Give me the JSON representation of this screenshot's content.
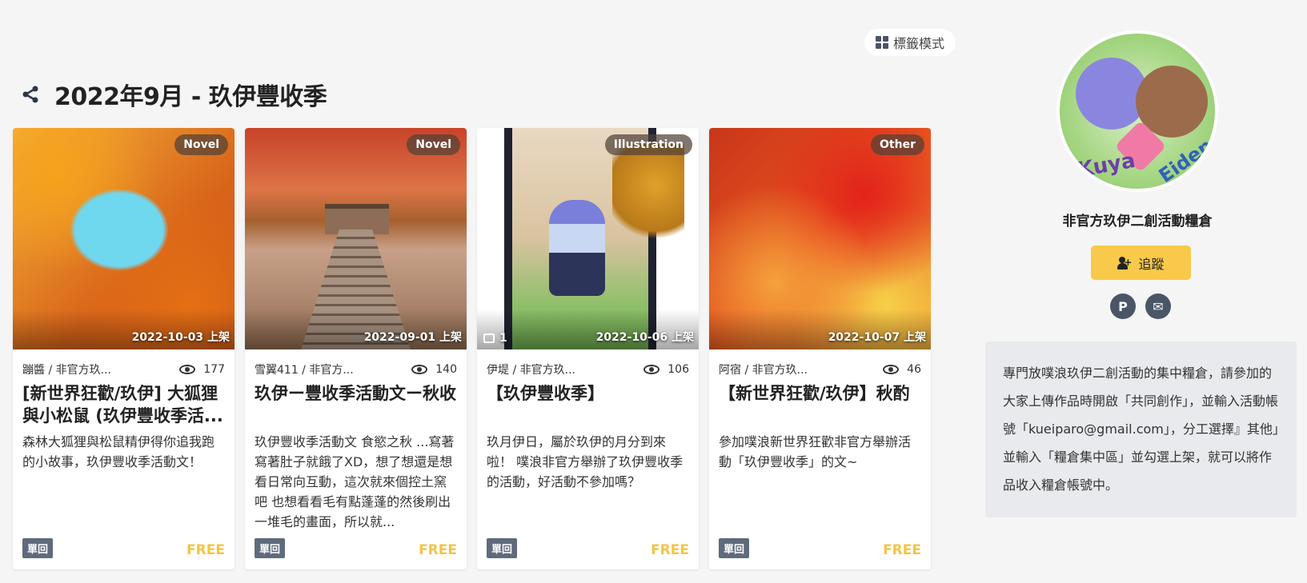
{
  "header": {
    "tag_mode_label": "標籤模式",
    "title": "2022年9月 - 玖伊豐收季"
  },
  "cards": [
    {
      "type": "Novel",
      "date": "2022-10-03 上架",
      "author": "蹦醬 / 非官方玖...",
      "views": "177",
      "title": "[新世界狂歡/玖伊] 大狐狸與小松鼠 (玖伊豐收季活...",
      "desc": "森林大狐狸與松鼠精伊得你追我跑的小故事，玖伊豐收季活動文！",
      "tag": "單回",
      "price": "FREE"
    },
    {
      "type": "Novel",
      "date": "2022-09-01 上架",
      "author": "雪翼411 / 非官方...",
      "views": "140",
      "title": "玖伊ー豐收季活動文ー秋收",
      "desc": "玖伊豐收季活動文 食慾之秋 ...寫著寫著肚子就餓了XD，想了想還是想看日常向互動，這次就來個控土窯吧 也想看看毛有點蓬蓬的然後刷出一堆毛的畫面，所以就...",
      "tag": "單回",
      "price": "FREE"
    },
    {
      "type": "Illustration",
      "date": "2022-10-06 上架",
      "image_count": "1",
      "author": "伊堤 / 非官方玖...",
      "views": "106",
      "title": "【玖伊豐收季】",
      "desc": "玖月伊日，屬於玖伊的月分到來啦！ 噗浪非官方舉辦了玖伊豐收季的活動，好活動不參加嗎？",
      "tag": "單回",
      "price": "FREE"
    },
    {
      "type": "Other",
      "date": "2022-10-07 上架",
      "author": "阿宿 / 非官方玖...",
      "views": "46",
      "title": "【新世界狂歡/玖伊】秋酌",
      "desc": "參加噗浪新世界狂歡非官方舉辦活動「玖伊豐收季」的文~",
      "tag": "單回",
      "price": "FREE"
    }
  ],
  "sidebar": {
    "avatar_text": [
      "Kuya",
      "Eiden"
    ],
    "page_name": "非官方玖伊二創活動糧倉",
    "follow_label": "追蹤",
    "social_icons": [
      "plurk-icon",
      "mail-icon"
    ],
    "about": "專門放噗浪玖伊二創活動的集中糧倉，請參加的大家上傳作品時開啟「共同創作」，並輸入活動帳號「kueiparo@gmail.com」，分工選擇』其他」並輸入「糧倉集中區」並勾選上架，就可以將作品收入糧倉帳號中。"
  },
  "colors": {
    "accent": "#f8c94a",
    "free": "#f6c343",
    "tag": "#5f6b7c"
  }
}
